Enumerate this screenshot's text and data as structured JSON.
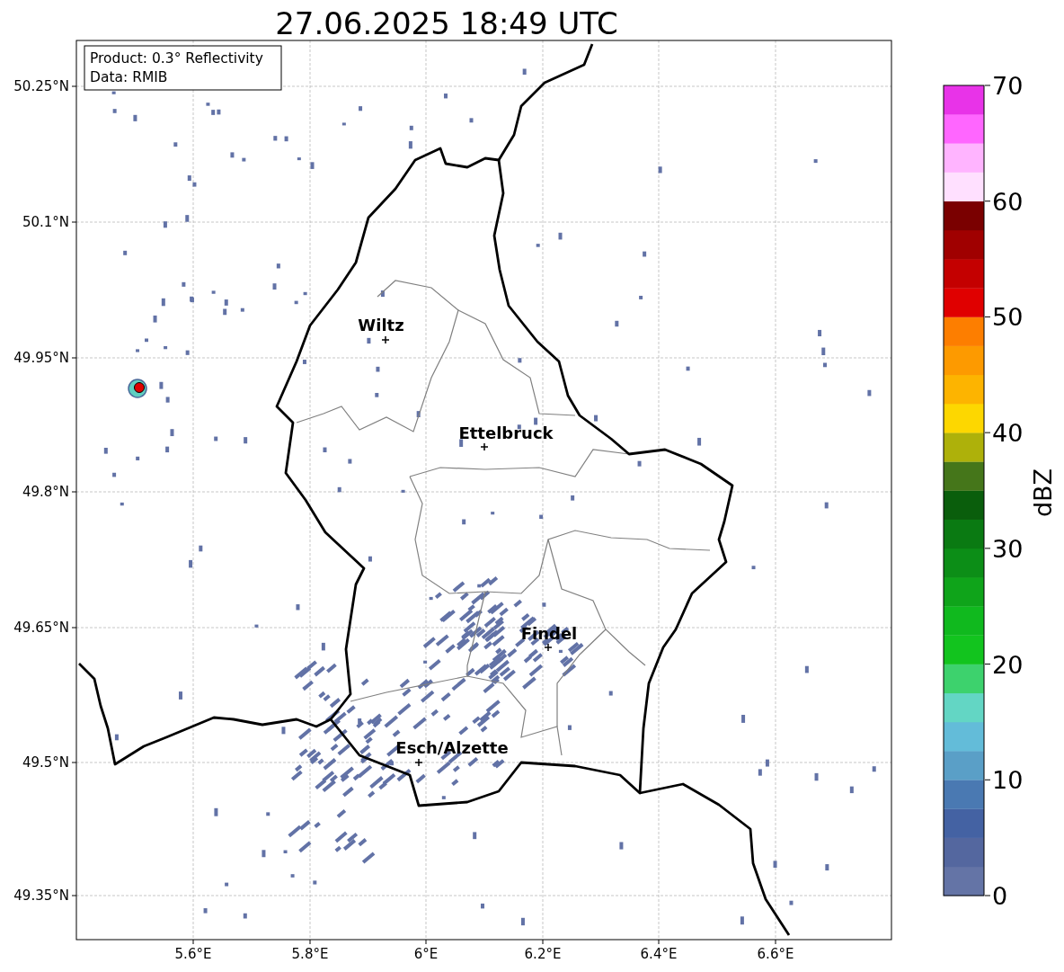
{
  "title": "27.06.2025 18:49 UTC",
  "legend": [
    "Product: 0.3° Reflectivity",
    "Data: RMIB"
  ],
  "x_ticks": [
    "5.6°E",
    "5.8°E",
    "6°E",
    "6.2°E",
    "6.4°E",
    "6.6°E"
  ],
  "y_ticks": [
    "50.25°N",
    "50.1°N",
    "49.95°N",
    "49.8°N",
    "49.65°N",
    "49.5°N",
    "49.35°N"
  ],
  "cities": [
    {
      "name": "Wiltz"
    },
    {
      "name": "Ettelbruck"
    },
    {
      "name": "Findel"
    },
    {
      "name": "Esch/Alzette"
    }
  ],
  "colorbar": {
    "label": "dBZ",
    "ticks": [
      "70",
      "60",
      "50",
      "40",
      "30",
      "20",
      "10",
      "0"
    ],
    "segments": [
      {
        "color": "#6474a6"
      },
      {
        "color": "#54679f"
      },
      {
        "color": "#4462a3"
      },
      {
        "color": "#4a79b2"
      },
      {
        "color": "#5a9fc7"
      },
      {
        "color": "#63bcd9"
      },
      {
        "color": "#63d6c4"
      },
      {
        "color": "#3dd26d"
      },
      {
        "color": "#12c41e"
      },
      {
        "color": "#10b91e"
      },
      {
        "color": "#0fa41a"
      },
      {
        "color": "#0c8e17"
      },
      {
        "color": "#0a7a12"
      },
      {
        "color": "#0a5e0c"
      },
      {
        "color": "#45761a"
      },
      {
        "color": "#aeb10a"
      },
      {
        "color": "#fdd700"
      },
      {
        "color": "#fdb400"
      },
      {
        "color": "#fd9a00"
      },
      {
        "color": "#fd7e00"
      },
      {
        "color": "#e00000"
      },
      {
        "color": "#c40000"
      },
      {
        "color": "#a00000"
      },
      {
        "color": "#7a0000"
      },
      {
        "color": "#ffe0ff"
      },
      {
        "color": "#ffb4ff"
      },
      {
        "color": "#ff66ff"
      },
      {
        "color": "#e833e8"
      }
    ]
  }
}
